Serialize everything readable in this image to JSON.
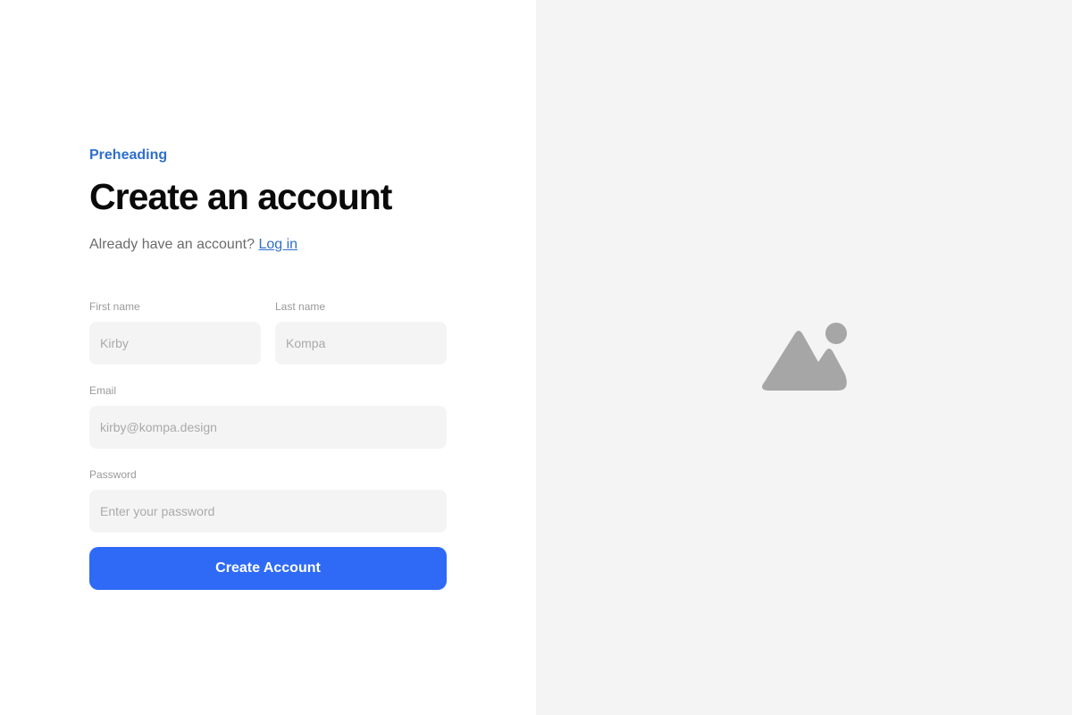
{
  "form": {
    "preheading": "Preheading",
    "title": "Create an account",
    "subtitle_text": "Already have an account?",
    "login_link": "Log in",
    "first_name": {
      "label": "First name",
      "placeholder": "Kirby"
    },
    "last_name": {
      "label": "Last name",
      "placeholder": "Kompa"
    },
    "email": {
      "label": "Email",
      "placeholder": "kirby@kompa.design"
    },
    "password": {
      "label": "Password",
      "placeholder": "Enter your password"
    },
    "submit_label": "Create Account"
  },
  "side_panel": {
    "icon": "image-placeholder-icon"
  },
  "colors": {
    "accent": "#2e6af6",
    "link": "#2f6fcc",
    "input_bg": "#f4f4f4",
    "panel_bg": "#f4f4f4",
    "icon": "#a6a6a6"
  }
}
